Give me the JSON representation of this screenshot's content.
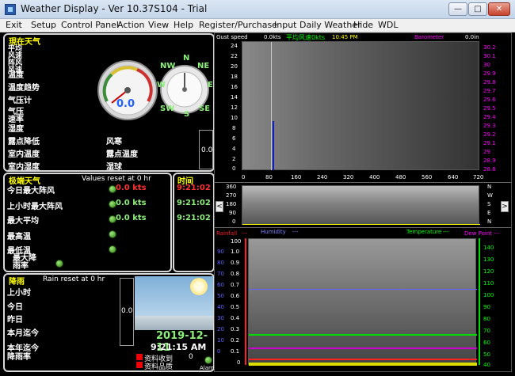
{
  "window": {
    "title": "Weather Display - Ver 10.37S104 - Trial",
    "minimize": "—",
    "maximize": "□",
    "close": "✕"
  },
  "menu": [
    "Exit",
    "Setup",
    "Control Panel",
    "Action",
    "View",
    "Help",
    "Register/Purchase",
    "Input Daily Weather",
    "Hide",
    "WDL"
  ],
  "current": {
    "header": "現在天气",
    "labels": [
      "平均",
      "风速",
      "阵风",
      "风速",
      "温度",
      "温度趋势",
      "气压计",
      "气压",
      "速率",
      "湿度"
    ],
    "dew": "露点降低",
    "windchill": "风寒",
    "indoor_temp": "室内温度",
    "indoor_dew": "露点温度",
    "indoor_hum": "室内湿度",
    "humidex": "湿球",
    "speed_value": "0.0",
    "side_value": "0.0",
    "compass": [
      "N",
      "NE",
      "E",
      "SE",
      "S",
      "SW",
      "W",
      "NW"
    ]
  },
  "extremes": {
    "header": "极端天气",
    "reset_note": "Values reset at 0 hr",
    "time_header": "时间",
    "rows": [
      {
        "label": "今日最大阵风",
        "value": "0.0 kts",
        "time": "9:21:02"
      },
      {
        "label": "上小时最大阵风",
        "value": "0.0 kts",
        "time": "9:21:02"
      },
      {
        "label": "最大平均",
        "value": "0.0 kts",
        "time": "9:21:02"
      },
      {
        "label": "最高温",
        "value": "",
        "time": ""
      },
      {
        "label": "最低温",
        "value": "",
        "time": ""
      },
      {
        "label": "最大降雨率",
        "value": "",
        "time": ""
      }
    ]
  },
  "rain": {
    "header": "降雨",
    "reset_note": "Rain reset at 0 hr",
    "labels": [
      "上小时",
      "今日",
      "昨日",
      "本月迄今",
      "本年迄今",
      "降雨率"
    ],
    "value": "0.0",
    "date": "2019-12-11",
    "time": "9:21:15 AM",
    "counter": "0",
    "legend1": "资料收到",
    "legend2": "资料品质",
    "alarm": "Alarm"
  },
  "wind_chart": {
    "left_label": "Gust speed",
    "value_label": "0.0kts",
    "avg_label": "平均风速0kts",
    "clock": "10:45 PM",
    "right_label": "Barometer",
    "right_value": "0.0in",
    "y_left": [
      "24",
      "22",
      "20",
      "18",
      "16",
      "14",
      "12",
      "10",
      "8",
      "6",
      "4",
      "2",
      "0"
    ],
    "y_right": [
      "30.2",
      "30.1",
      "30",
      "29.9",
      "29.8",
      "29.7",
      "29.6",
      "29.5",
      "29.4",
      "29.3",
      "29.2",
      "29.1",
      "29",
      "28.9",
      "28.8"
    ],
    "x": [
      "0",
      "80",
      "160",
      "240",
      "320",
      "400",
      "480",
      "560",
      "640",
      "720"
    ]
  },
  "dir_chart": {
    "y_left": [
      "360",
      "270",
      "180",
      "90",
      "0"
    ],
    "y_right": [
      "N",
      "W",
      "S",
      "E",
      "N"
    ],
    "humidity_label": "Humidity",
    "hum_dash": "---",
    "temp_label": "Temperature",
    "temp_dash": "---",
    "prev": "<",
    "next": ">"
  },
  "rain_chart": {
    "left_label": "Rainfall",
    "left_dash": "---",
    "right_label": "Dew Point",
    "right_dash": "---",
    "y_left": [
      "100",
      "1.0",
      "0.9",
      "0.8",
      "0.7",
      "0.6",
      "0.5",
      "0.4",
      "0.3",
      "0.2",
      "0.1",
      "0"
    ],
    "y_mid": [
      "100",
      "90",
      "80",
      "70",
      "60",
      "50",
      "40",
      "30",
      "20",
      "10",
      "0"
    ],
    "y_right": [
      "140",
      "130",
      "120",
      "110",
      "100",
      "90",
      "80",
      "70",
      "60",
      "50",
      "40"
    ]
  },
  "colors": {
    "accent": "#ffff00",
    "green": "#00cc00",
    "magenta": "#ff00ff",
    "red": "#ff0000"
  }
}
